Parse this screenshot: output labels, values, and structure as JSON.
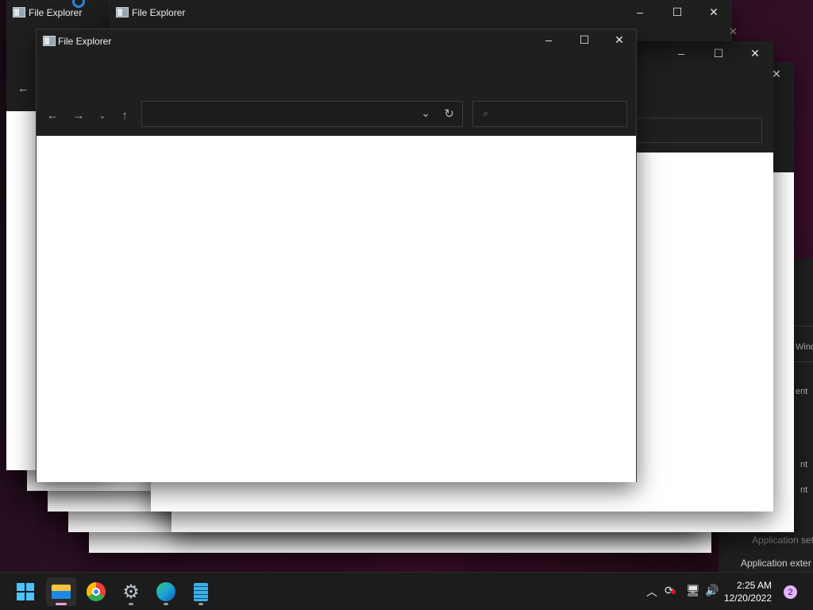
{
  "windows": {
    "title": "File Explorer",
    "back_title": "File Explorer",
    "front_title": "File Explorer"
  },
  "icons": {
    "minimize": "minimize-icon",
    "maximize": "maximize-icon",
    "close": "close-icon",
    "back": "back-arrow-icon",
    "forward": "forward-arrow-icon",
    "recent": "chevron-down-icon",
    "up": "up-arrow-icon",
    "refresh": "refresh-icon",
    "search": "search-icon"
  },
  "background_panel": {
    "partial_lines": [
      "Wind",
      "ent",
      "nt",
      "nt",
      "Application set",
      "Application exter"
    ]
  },
  "taskbar": {
    "apps": [
      "Start",
      "File Explorer",
      "Google Chrome",
      "Settings",
      "Microsoft Edge",
      "Notepad"
    ],
    "time": "2:25 AM",
    "date": "12/20/2022",
    "notification_count": "2"
  },
  "colors": {
    "titlebar": "#1f1f1f",
    "content": "#ffffff",
    "taskbar": "#1c1c1c",
    "accent": "#0078d4",
    "badge": "#e6b4ff"
  }
}
